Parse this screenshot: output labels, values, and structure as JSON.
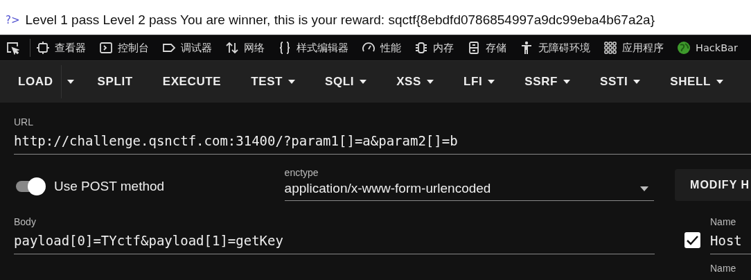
{
  "page": {
    "prompt": "?>",
    "text": "Level 1 pass Level 2 pass You are winner, this is your reward: sqctf{8ebdfd0786854997a9dc99eba4b67a2a}"
  },
  "devtools_tabs": [
    {
      "label": "查看器"
    },
    {
      "label": "控制台"
    },
    {
      "label": "调试器"
    },
    {
      "label": "网络"
    },
    {
      "label": "样式编辑器"
    },
    {
      "label": "性能"
    },
    {
      "label": "内存"
    },
    {
      "label": "存储"
    },
    {
      "label": "无障碍环境"
    },
    {
      "label": "应用程序"
    },
    {
      "label": "HackBar"
    }
  ],
  "hackbar_buttons": [
    {
      "label": "LOAD",
      "kind": "split"
    },
    {
      "label": "SPLIT",
      "kind": "plain"
    },
    {
      "label": "EXECUTE",
      "kind": "plain"
    },
    {
      "label": "TEST",
      "kind": "menu"
    },
    {
      "label": "SQLI",
      "kind": "menu"
    },
    {
      "label": "XSS",
      "kind": "menu"
    },
    {
      "label": "LFI",
      "kind": "menu"
    },
    {
      "label": "SSRF",
      "kind": "menu"
    },
    {
      "label": "SSTI",
      "kind": "menu"
    },
    {
      "label": "SHELL",
      "kind": "menu"
    }
  ],
  "url": {
    "label": "URL",
    "value": "http://challenge.qsnctf.com:31400/?param1[]=a&param2[]=b"
  },
  "post_toggle": {
    "label": "Use POST method",
    "on": true
  },
  "enctype": {
    "label": "enctype",
    "value": "application/x-www-form-urlencoded"
  },
  "modify_button": {
    "label": "MODIFY H"
  },
  "body": {
    "label": "Body",
    "value": "payload[0]=TYctf&payload[1]=getKey"
  },
  "headers": [
    {
      "checked": true,
      "name_label": "Name",
      "name": "Host"
    },
    {
      "name_label": "Name"
    }
  ]
}
